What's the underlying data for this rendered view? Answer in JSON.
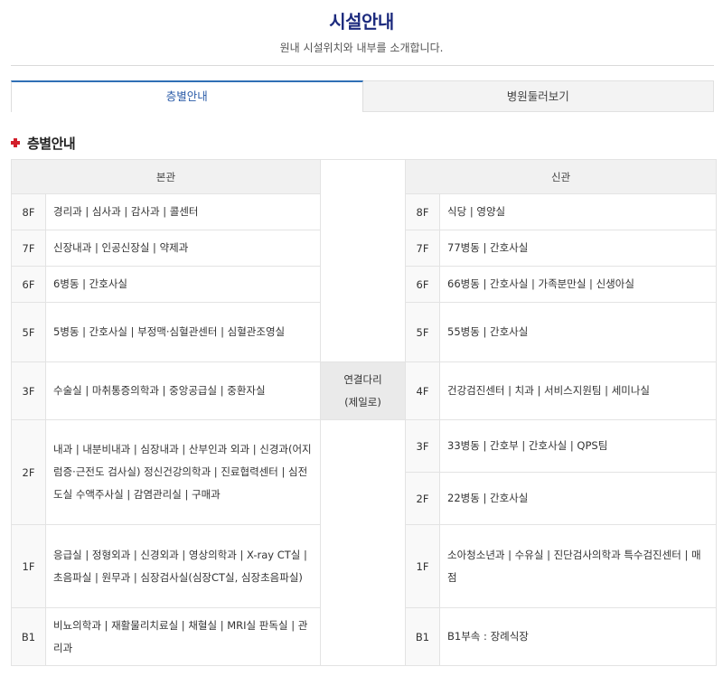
{
  "header": {
    "title": "시설안내",
    "subtitle": "원내 시설위치와 내부를 소개합니다."
  },
  "tabs": [
    {
      "label": "층별안내",
      "active": true
    },
    {
      "label": "병원둘러보기",
      "active": false
    }
  ],
  "section": {
    "title": "층별안내"
  },
  "table": {
    "main_building": "본관",
    "new_building": "신관",
    "bridge_line1": "연결다리",
    "bridge_line2": "(제일로)",
    "main_floors": [
      {
        "floor": "8F",
        "text": "경리과 | 심사과 | 감사과 | 콜센터"
      },
      {
        "floor": "7F",
        "text": "신장내과 | 인공신장실 | 약제과"
      },
      {
        "floor": "6F",
        "text": "6병동 | 간호사실"
      },
      {
        "floor": "5F",
        "text": "5병동 | 간호사실 | 부정맥·심혈관센터 | 심혈관조영실"
      },
      {
        "floor": "3F",
        "text": "수술실 | 마취통증의학과 | 중앙공급실 | 중환자실"
      },
      {
        "floor": "2F",
        "text": "내과 | 내분비내과 | 심장내과 | 산부인과 외과 | 신경과(어지럼증·근전도 검사실) 정신건강의학과 | 진료협력센터 | 심전도실 수액주사실 | 감염관리실 | 구매과"
      },
      {
        "floor": "1F",
        "text": "응급실 | 정형외과 | 신경외과 | 영상의학과 | X-ray CT실 | 초음파실 | 원무과 | 심장검사실(심장CT실, 심장초음파실)"
      },
      {
        "floor": "B1",
        "text": "비뇨의학과 | 재활물리치료실 | 채혈실 | MRI실 판독실 | 관리과"
      }
    ],
    "new_floors": [
      {
        "floor": "8F",
        "text": "식당 | 영양실"
      },
      {
        "floor": "7F",
        "text": "77병동 | 간호사실"
      },
      {
        "floor": "6F",
        "text": "66병동 | 간호사실 | 가족분만실 | 신생아실"
      },
      {
        "floor": "5F",
        "text": "55병동 | 간호사실"
      },
      {
        "floor": "4F",
        "text": "건강검진센터 | 치과 | 서비스지원팀 | 세미나실"
      },
      {
        "floor": "3F",
        "text": "33병동 | 간호부 | 간호사실 | QPS팀"
      },
      {
        "floor": "2F",
        "text": "22병동 | 간호사실"
      },
      {
        "floor": "1F",
        "text": "소아청소년과 | 수유실 | 진단검사의학과 특수검진센터 | 매점"
      },
      {
        "floor": "B1",
        "text": "B1부속 : 장례식장"
      }
    ]
  }
}
